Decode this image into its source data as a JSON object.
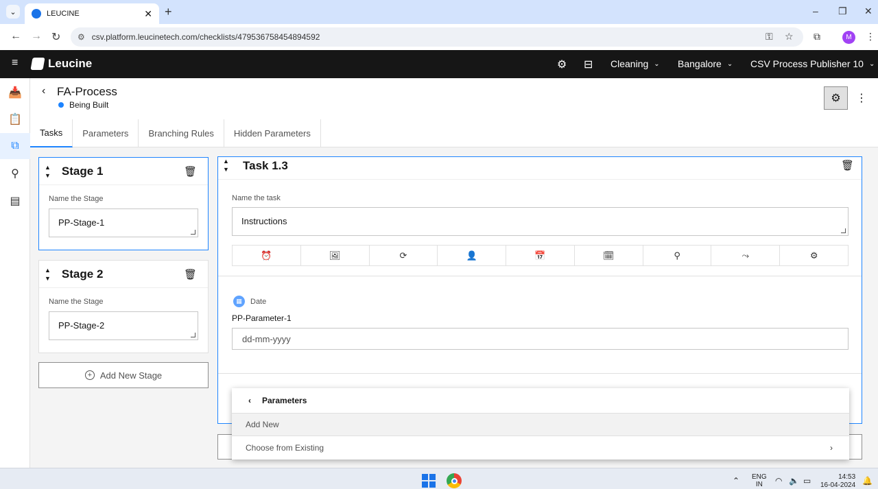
{
  "browser": {
    "tab_title": "LEUCINE",
    "url": "csv.platform.leucinetech.com/checklists/479536758454894592",
    "profile_initial": "M"
  },
  "app": {
    "logo": "Leucine",
    "facility_dropdown": "Cleaning",
    "location_dropdown": "Bangalore",
    "user_dropdown": "CSV Process Publisher 10"
  },
  "page": {
    "title": "FA-Process",
    "status": "Being Built",
    "status_color": "#1d84ff",
    "tabs": [
      "Tasks",
      "Parameters",
      "Branching Rules",
      "Hidden Parameters"
    ]
  },
  "stages": [
    {
      "heading": "Stage 1",
      "label": "Name the Stage",
      "value": "PP-Stage-1"
    },
    {
      "heading": "Stage 2",
      "label": "Name the Stage",
      "value": "PP-Stage-2"
    }
  ],
  "add_stage_label": "Add New Stage",
  "task": {
    "heading": "Task 1.3",
    "name_label": "Name the task",
    "name_value": "Instructions",
    "parameter": {
      "type": "Date",
      "name": "PP-Parameter-1",
      "placeholder": "dd-mm-yyyy"
    }
  },
  "popup": {
    "title": "Parameters",
    "items": [
      "Add New",
      "Choose from Existing"
    ]
  },
  "taskbar": {
    "lang_top": "ENG",
    "lang_bottom": "IN",
    "time": "14:53",
    "date": "16-04-2024"
  }
}
